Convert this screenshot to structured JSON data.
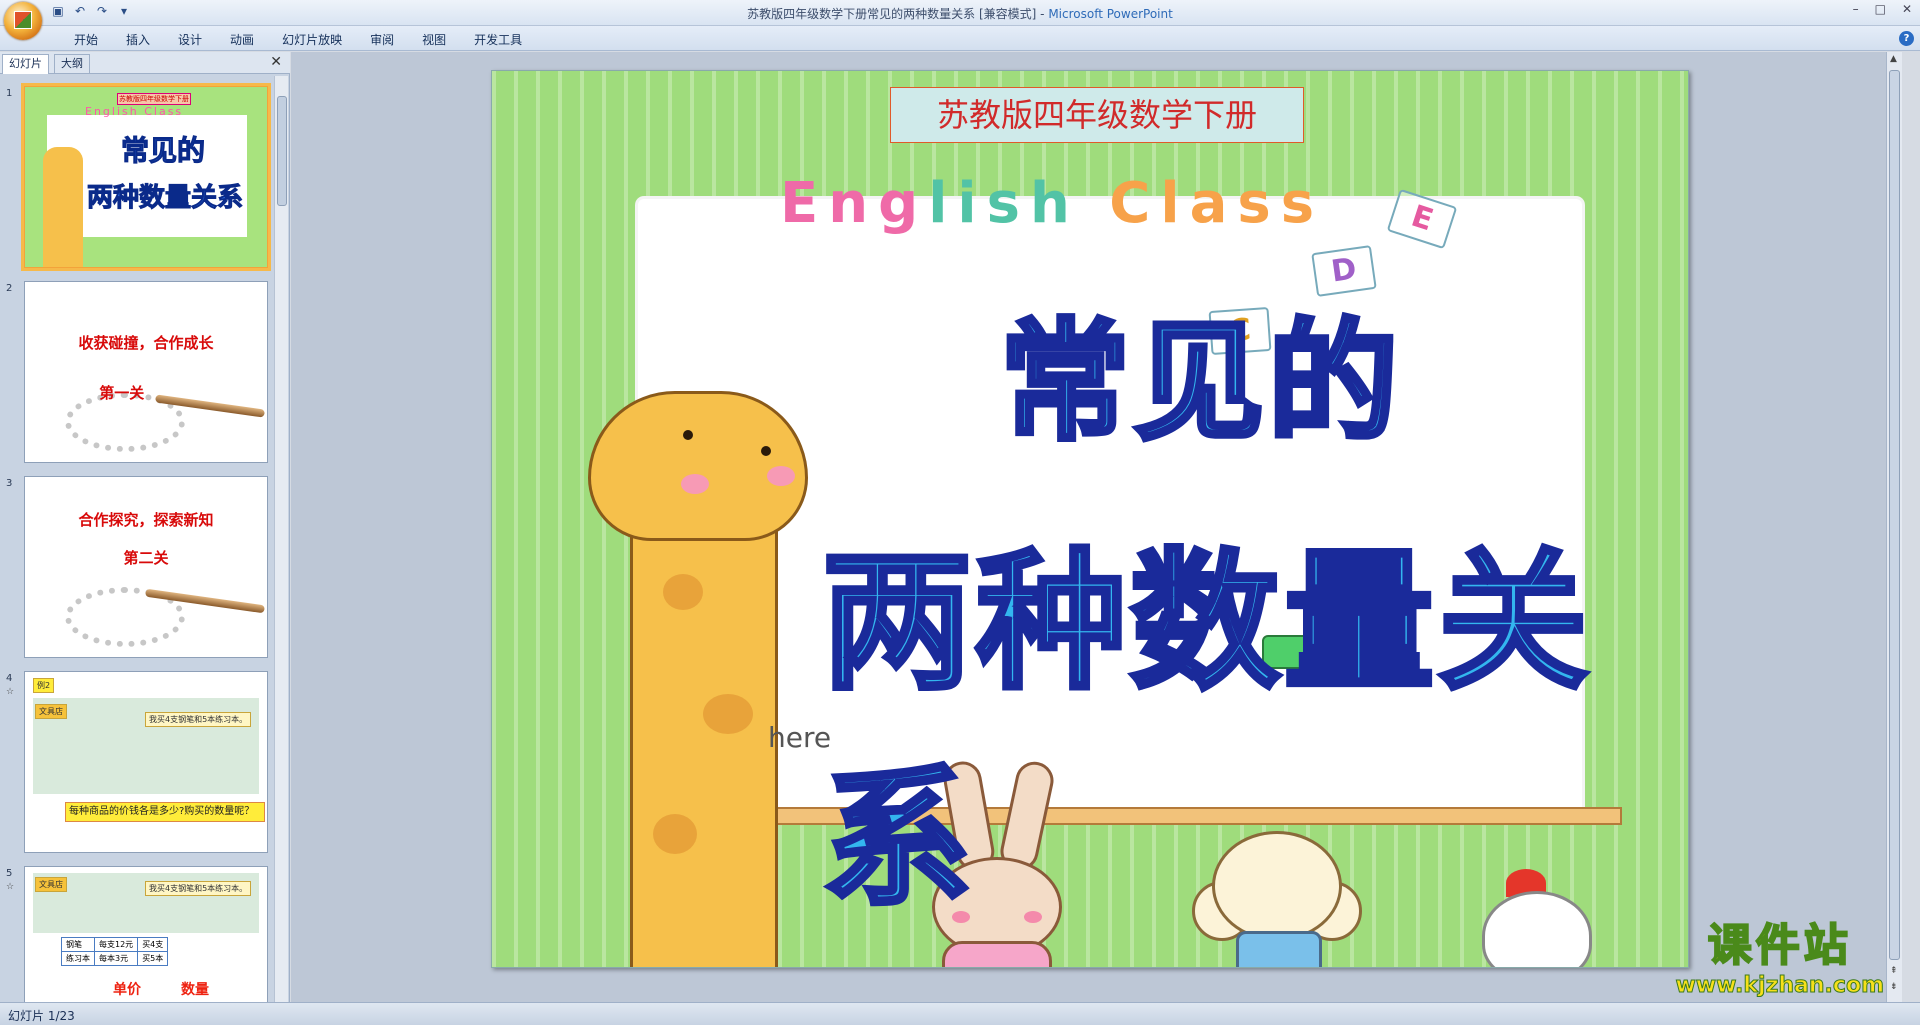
{
  "window": {
    "title": "苏教版四年级数学下册常见的两种数量关系 [兼容模式]",
    "app": "Microsoft PowerPoint",
    "separator": " - ",
    "controls": [
      "–",
      "□",
      "✕"
    ]
  },
  "ribbon": {
    "tabs": [
      "开始",
      "插入",
      "设计",
      "动画",
      "幻灯片放映",
      "审阅",
      "视图",
      "开发工具"
    ],
    "help": "?"
  },
  "left_panel": {
    "tabs": [
      "幻灯片",
      "大纲"
    ],
    "close": "✕",
    "slides": [
      {
        "num": "1",
        "tag": "苏教版四年级数学下册",
        "eng": "English Class",
        "line1": "常见的",
        "line2": "两种数量关系"
      },
      {
        "num": "2",
        "title": "收获碰撞，合作成长",
        "sub": "第一关"
      },
      {
        "num": "3",
        "title": "合作探究，探索新知",
        "sub": "第二关"
      },
      {
        "num": "4",
        "star": "☆",
        "tag": "例2",
        "shop": "文具店",
        "bubble": "我买4支钢笔和5本练习本。",
        "banner": "每种商品的价钱各是多少?购买的数量呢？"
      },
      {
        "num": "5",
        "star": "☆",
        "shop": "文具店",
        "bubble": "我买4支钢笔和5本练习本。",
        "table": [
          [
            "钢笔",
            "每支12元",
            "买4支"
          ],
          [
            "练习本",
            "每本3元",
            "买5本"
          ]
        ],
        "unit_price": "单价",
        "quantity": "数量"
      }
    ]
  },
  "slide": {
    "tag": "苏教版四年级数学下册",
    "english": [
      "Eng",
      "lish",
      " Class"
    ],
    "title_line1": "常见的",
    "title_line2": "两种数量关系",
    "here": "here",
    "cards": [
      "E",
      "D",
      "C"
    ]
  },
  "watermark": {
    "name": "课件站",
    "url": "www.kjzhan.com"
  },
  "status": {
    "slide_info": "幻灯片 1/23"
  },
  "colors": {
    "title_fill": "#33b6ef",
    "title_stroke": "#1a2a9a",
    "slide_bg": "#9fdc7c",
    "red_text": "#d80a0a"
  }
}
